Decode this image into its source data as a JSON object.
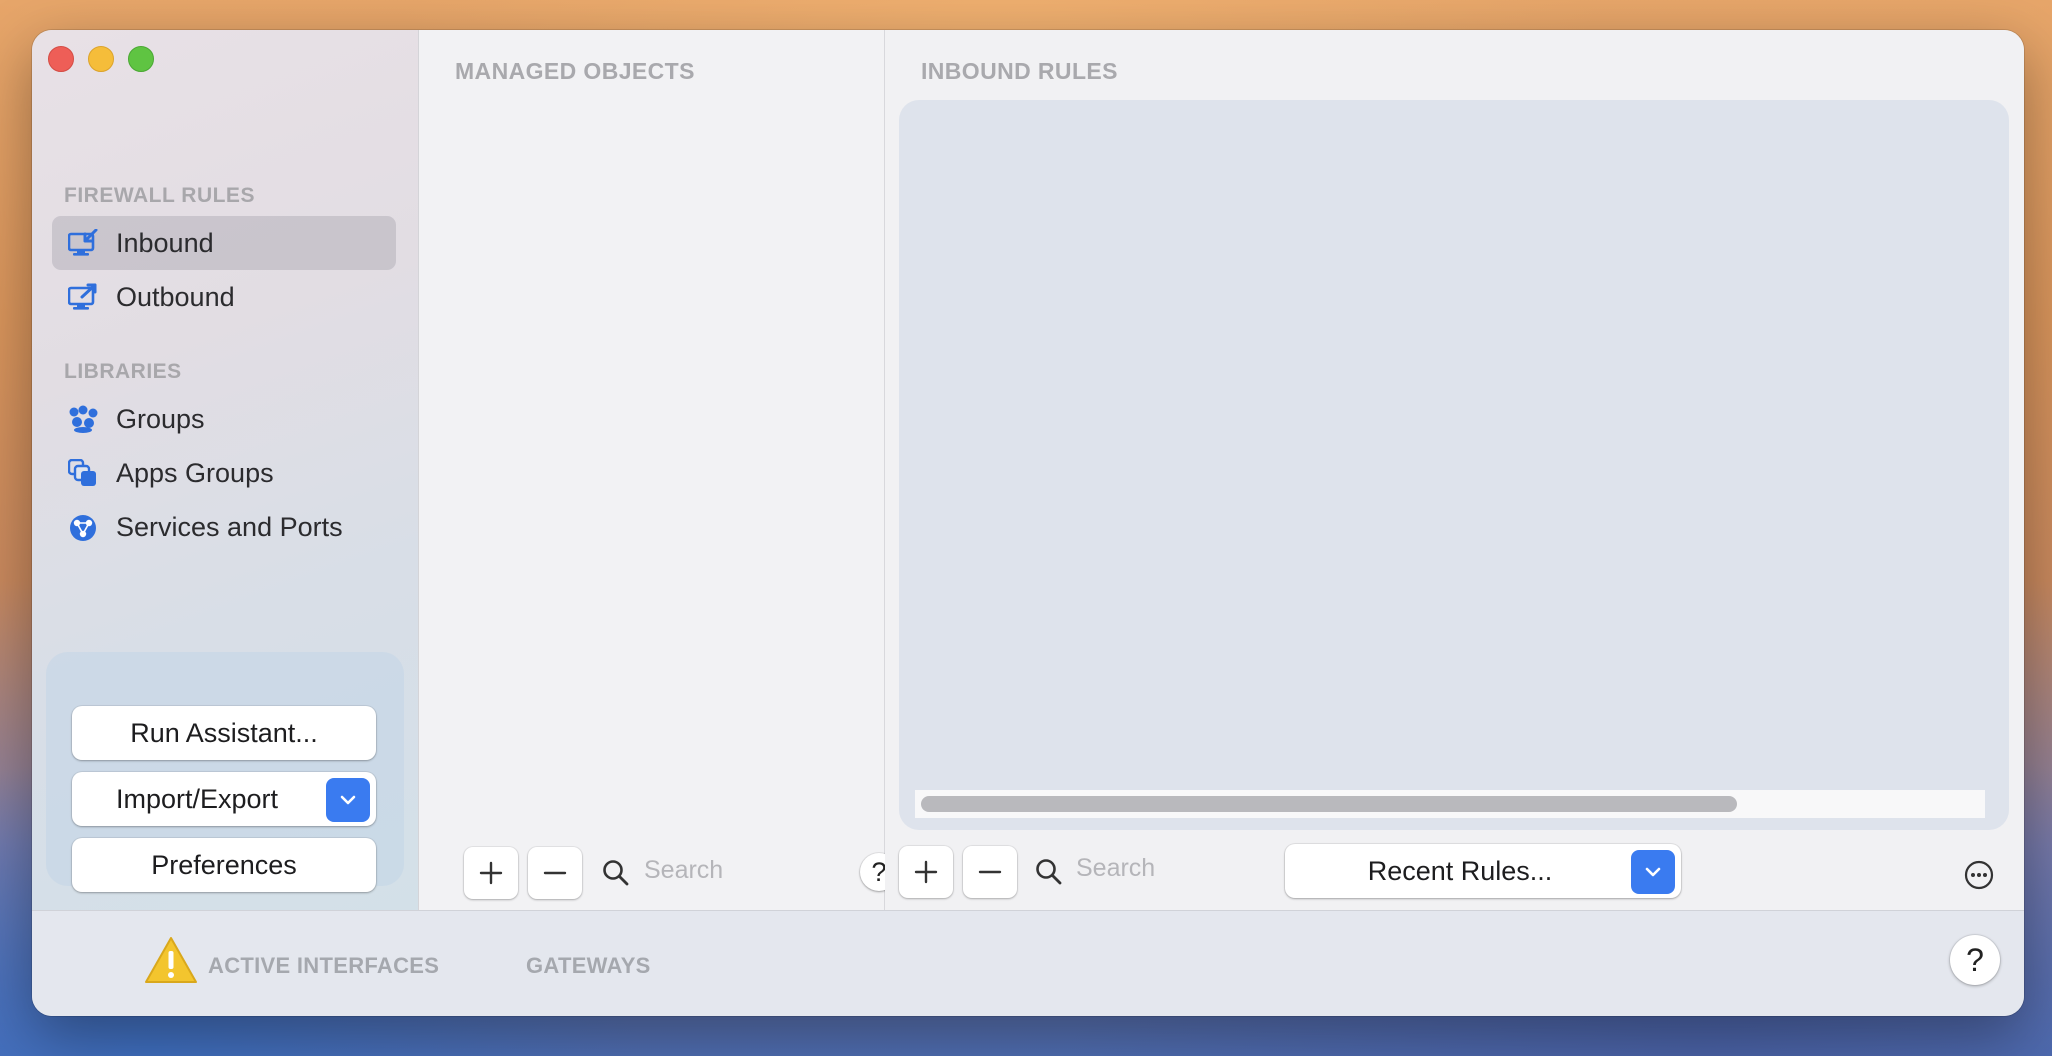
{
  "sidebar": {
    "firewall_header": "FIREWALL RULES",
    "firewall_items": [
      {
        "label": "Inbound",
        "icon": "inbound-monitor-icon",
        "selected": true
      },
      {
        "label": "Outbound",
        "icon": "outbound-monitor-icon",
        "selected": false
      }
    ],
    "libraries_header": "LIBRARIES",
    "library_items": [
      {
        "label": "Groups",
        "icon": "groups-icon"
      },
      {
        "label": "Apps Groups",
        "icon": "apps-groups-icon"
      },
      {
        "label": "Services and Ports",
        "icon": "services-globe-icon"
      }
    ],
    "run_assistant_label": "Run Assistant...",
    "import_export_label": "Import/Export",
    "preferences_label": "Preferences"
  },
  "managed_objects": {
    "title": "MANAGED OBJECTS",
    "search_placeholder": "Search",
    "help_label": "?"
  },
  "inbound_rules": {
    "title": "INBOUND RULES",
    "search_placeholder": "Search",
    "recent_rules_label": "Recent Rules..."
  },
  "bottom_bar": {
    "active_interfaces_label": "ACTIVE INTERFACES",
    "gateways_label": "GATEWAYS",
    "help_label": "?"
  },
  "colors": {
    "accent_blue": "#3a7bf0",
    "icon_blue": "#2f6fdc",
    "warning_yellow": "#f3c52e"
  }
}
